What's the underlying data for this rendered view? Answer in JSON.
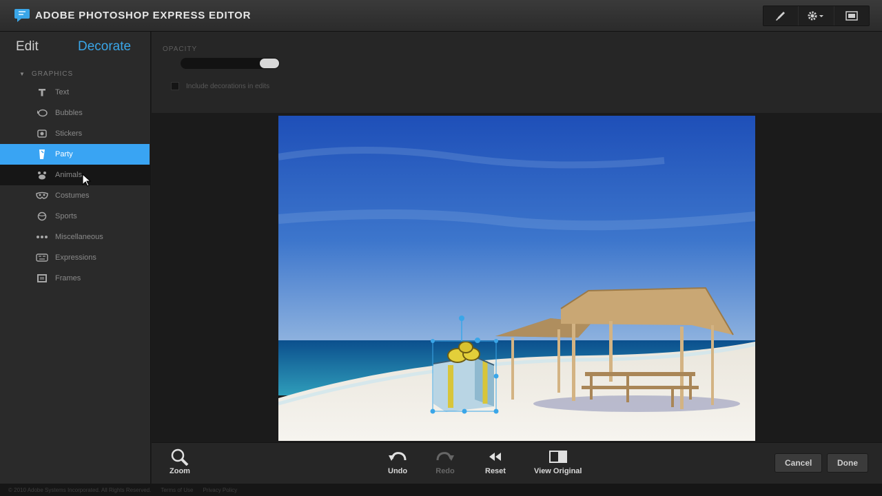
{
  "app": {
    "title": "ADOBE PHOTOSHOP EXPRESS EDITOR"
  },
  "top_tools": [
    {
      "name": "brush-icon"
    },
    {
      "name": "gear-icon"
    },
    {
      "name": "fullscreen-icon"
    }
  ],
  "tabs": {
    "edit": "Edit",
    "decorate": "Decorate"
  },
  "graphics": {
    "section_label": "GRAPHICS",
    "items": [
      {
        "label": "Text",
        "icon": "text-icon"
      },
      {
        "label": "Bubbles",
        "icon": "speech-bubble-icon"
      },
      {
        "label": "Stickers",
        "icon": "sticker-icon"
      },
      {
        "label": "Party",
        "icon": "party-icon"
      },
      {
        "label": "Animals",
        "icon": "animal-icon"
      },
      {
        "label": "Costumes",
        "icon": "mask-icon"
      },
      {
        "label": "Sports",
        "icon": "sports-icon"
      },
      {
        "label": "Miscellaneous",
        "icon": "misc-icon"
      },
      {
        "label": "Expressions",
        "icon": "expressions-icon"
      },
      {
        "label": "Frames",
        "icon": "frame-icon"
      }
    ],
    "selected": "Party",
    "hovered": "Animals"
  },
  "options": {
    "opacity_label": "OPACITY",
    "opacity_level": 1.0,
    "checkbox_label": "Include decorations in edits"
  },
  "bottom": {
    "zoom": "Zoom",
    "undo": "Undo",
    "redo": "Redo",
    "reset": "Reset",
    "view_original": "View Original",
    "cancel": "Cancel",
    "done": "Done"
  },
  "footer": {
    "copyright": "© 2010 Adobe Systems Incorporated. All Rights Reserved.",
    "terms": "Terms of Use",
    "privacy": "Privacy Policy"
  },
  "colors": {
    "accent": "#39a4f3",
    "decorate_tab": "#3aa6e8"
  }
}
